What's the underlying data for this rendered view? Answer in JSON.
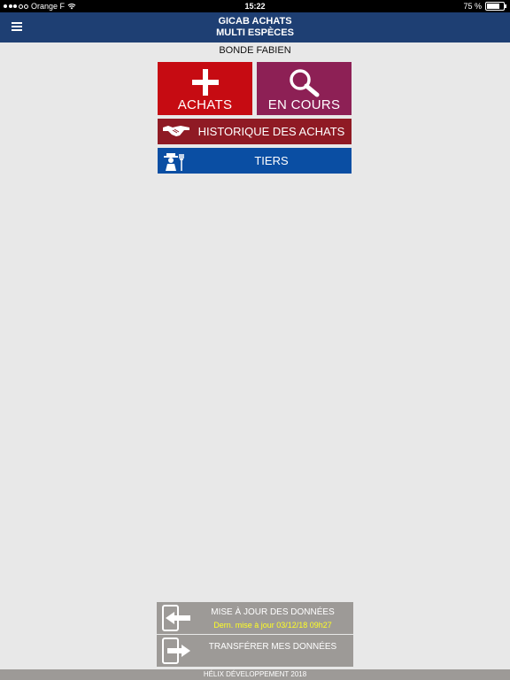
{
  "status_bar": {
    "carrier": "Orange F",
    "time": "15:22",
    "battery": "75 %",
    "battery_level": 0.75
  },
  "header": {
    "title_line1": "GICAB ACHATS",
    "title_line2": "MULTI ESPÈCES",
    "menu_icon": "hamburger-menu-icon"
  },
  "user": {
    "name": "BONDE FABIEN"
  },
  "tiles": {
    "achats": {
      "label": "ACHATS",
      "icon": "plus-icon",
      "color": "#c60b12"
    },
    "en_cours": {
      "label": "EN COURS",
      "icon": "magnifier-icon",
      "color": "#8d2055"
    },
    "historique": {
      "label": "HISTORIQUE DES ACHATS",
      "icon": "handshake-icon",
      "color": "#8f1a24"
    },
    "tiers": {
      "label": "TIERS",
      "icon": "farmer-icon",
      "color": "#0a4ea3"
    }
  },
  "sync": {
    "update": {
      "label": "MISE À JOUR DES DONNÉES",
      "last_update": "Dern. mise à jour 03/12/18 09h27",
      "icon": "device-arrow-left-icon"
    },
    "transfer": {
      "label": "TRANSFÉRER MES DONNÉES",
      "icon": "device-arrow-right-icon"
    }
  },
  "footer": {
    "text": "HÉLIX DÉVELOPPEMENT 2018"
  }
}
